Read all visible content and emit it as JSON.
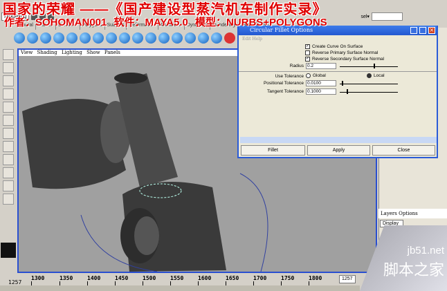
{
  "overlay": {
    "title": "国家的荣耀 ——《国产建设型蒸汽机车制作实录》",
    "credits": "作者：SOHOMAN001  软件：MAYA5.0  模型：NURBS+POLYGONS"
  },
  "toolbar": {
    "mode": "Modeling",
    "sel_label": "sel▾"
  },
  "shelf_tabs": [
    "General",
    "Curves",
    "Surfaces",
    "Polygons",
    "Subdivs",
    "Deformation",
    "Animation",
    "Dynamics",
    "Rendering",
    "PaintEffects"
  ],
  "viewport": {
    "panel_menu": "View Shading Lighting Show Panels"
  },
  "dialog": {
    "title": "Circular Fillet Options",
    "menu": "Edit  Help",
    "create_curve": "Create Curve On Surface",
    "rev_primary": "Reverse Primary Surface Normal",
    "rev_secondary": "Reverse Secondary Surface Normal",
    "radius_label": "Radius",
    "radius": "0.2",
    "use_tol_label": "Use Tolerance",
    "global": "Global",
    "local": "Local",
    "pos_tol_label": "Positional Tolerance",
    "pos_tol": "0.0100",
    "tan_tol_label": "Tangent Tolerance",
    "tan_tol": "0.1000",
    "fillet": "Fillet",
    "apply": "Apply",
    "close": "Close"
  },
  "layers": {
    "label": "Layers  Options",
    "display": "Display"
  },
  "timeline": {
    "start": "1257",
    "ticks": [
      "1300",
      "1350",
      "1400",
      "1450",
      "1500",
      "1550",
      "1600",
      "1650",
      "1700",
      "1750",
      "1800"
    ],
    "current": "1257"
  },
  "watermark": {
    "site": "jb51.net",
    "name": "脚本之家"
  }
}
